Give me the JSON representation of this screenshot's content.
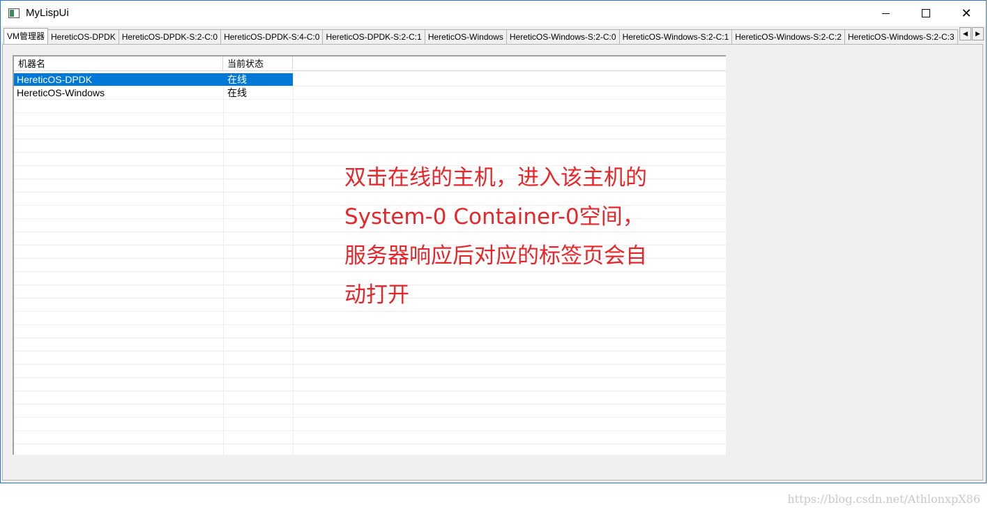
{
  "window": {
    "title": "MyLispUi",
    "controls": {
      "minimize": "minimize-icon",
      "maximize": "maximize-icon",
      "close": "close-icon"
    }
  },
  "tabs": [
    {
      "label": "VM管理器",
      "active": true
    },
    {
      "label": "HereticOS-DPDK",
      "active": false
    },
    {
      "label": "HereticOS-DPDK-S:2-C:0",
      "active": false
    },
    {
      "label": "HereticOS-DPDK-S:4-C:0",
      "active": false
    },
    {
      "label": "HereticOS-DPDK-S:2-C:1",
      "active": false
    },
    {
      "label": "HereticOS-Windows",
      "active": false
    },
    {
      "label": "HereticOS-Windows-S:2-C:0",
      "active": false
    },
    {
      "label": "HereticOS-Windows-S:2-C:1",
      "active": false
    },
    {
      "label": "HereticOS-Windows-S:2-C:2",
      "active": false
    },
    {
      "label": "HereticOS-Windows-S:2-C:3",
      "active": false
    }
  ],
  "tab_scroll": {
    "left": "◀",
    "right": "▶"
  },
  "list": {
    "columns": [
      "机器名",
      "当前状态"
    ],
    "rows": [
      {
        "name": "HereticOS-DPDK",
        "status": "在线",
        "selected": true
      },
      {
        "name": "HereticOS-Windows",
        "status": "在线",
        "selected": false
      }
    ]
  },
  "annotation": {
    "lines": [
      "双击在线的主机，进入该主机的",
      "System-0 Container-0空间，",
      "服务器响应后对应的标签页会自",
      "动打开"
    ],
    "color": "#e8262a"
  },
  "watermark": "https://blog.csdn.net/AthlonxpX86",
  "colors": {
    "selection": "#0078d7",
    "window_border": "#2b74c8"
  }
}
